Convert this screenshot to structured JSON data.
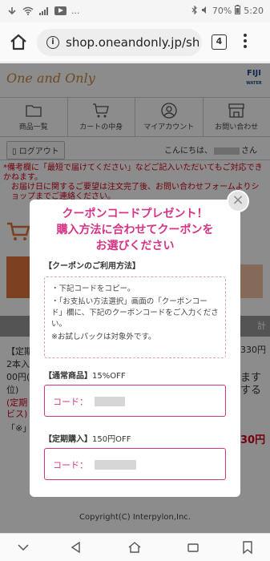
{
  "status_bar": {
    "battery": "70%",
    "time": "5:20",
    "dots": "..."
  },
  "browser": {
    "url": "shop.oneandonly.jp/sho",
    "tab_count": "4"
  },
  "site": {
    "logo": "One and Only",
    "fiji_logo": "FIJI",
    "fiji_sub": "WATER",
    "nav": [
      {
        "label": "商品一覧",
        "icon": "folder-icon"
      },
      {
        "label": "カートの中身",
        "icon": "cart-icon"
      },
      {
        "label": "マイアカウント",
        "icon": "account-icon"
      },
      {
        "label": "お問い合わせ",
        "icon": "store-icon"
      }
    ],
    "logout": "ログアウト",
    "greeting_pre": "こんにちは、",
    "greeting_post": "さん",
    "notice_1": "*備考欄に「最短で届けてください」などご記入いただいてもご対応できかねます。",
    "notice_2": "お届け日に関するご要望は注文完了後、お問い合わせフォームよりショップまでご連絡ください。"
  },
  "background_text": {
    "price_right": "330円",
    "left_1": "【定期",
    "left_2": "2本入",
    "left_3": "00円(",
    "left_4": "位)",
    "left_5": "(定期",
    "left_6": "ビス)",
    "right_mid": "ます",
    "right_mid2": "する",
    "left_bottom": "「※」",
    "right_bottom": "30円",
    "top_right": "計",
    "footer": "Copyright(C) Interpylon,Inc."
  },
  "modal": {
    "title_line1": "クーポンコードプレゼント！",
    "title_line2": "購入方法に合わせてクーポンを",
    "title_line3": "お選びください",
    "usage_heading": "【クーポンのご利用方法】",
    "usage_1": "・下記コードをコピー。",
    "usage_2": "・「お支払い方法選択」画面の「クーポンコード」欄に、下記のクーポンコードをご入力ください。",
    "usage_3": "※お試しパックは対象外です。",
    "regular_label": "【通常商品】",
    "regular_discount": "15%OFF",
    "subscription_label": "【定期購入】",
    "subscription_discount": "150円OFF",
    "code_label": "コード：",
    "close": "×"
  }
}
